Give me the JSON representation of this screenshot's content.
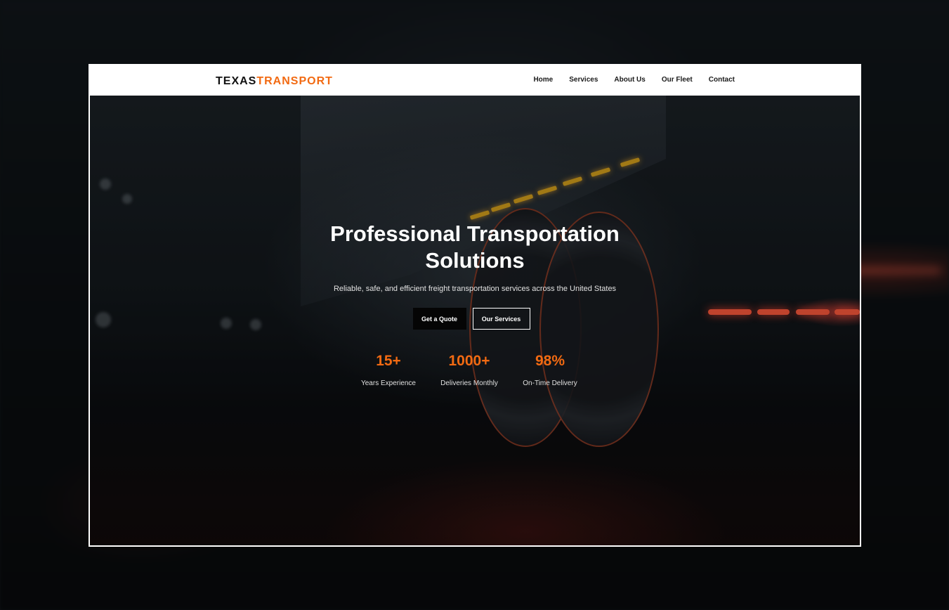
{
  "brand": {
    "logo_primary": "TEXAS",
    "logo_accent": "TRANSPORT",
    "accent_color": "#f26a12"
  },
  "nav": {
    "items": [
      {
        "label": "Home"
      },
      {
        "label": "Services"
      },
      {
        "label": "About Us"
      },
      {
        "label": "Our Fleet"
      },
      {
        "label": "Contact"
      }
    ]
  },
  "hero": {
    "title_line1": "Professional Transportation",
    "title_line2": "Solutions",
    "subtitle": "Reliable, safe, and efficient freight transportation services across the United States",
    "primary_button": "Get a Quote",
    "secondary_button": "Our Services"
  },
  "stats": [
    {
      "value": "15+",
      "label": "Years Experience"
    },
    {
      "value": "1000+",
      "label": "Deliveries Monthly"
    },
    {
      "value": "98%",
      "label": "On-Time Delivery"
    }
  ]
}
